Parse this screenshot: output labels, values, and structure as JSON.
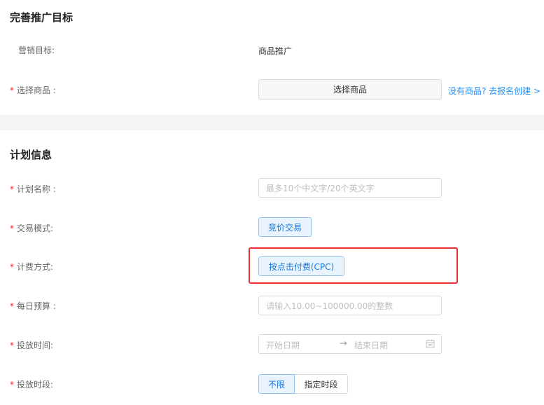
{
  "section1": {
    "title": "完善推广目标",
    "goal_label": "营销目标:",
    "goal_value": "商品推广",
    "product_label": "选择商品 :",
    "product_button": "选择商品",
    "product_link": "没有商品? 去报名创建 >"
  },
  "section2": {
    "title": "计划信息",
    "name_label": "计划名称 :",
    "name_placeholder": "最多10个中文字/20个英文字",
    "mode_label": "交易模式:",
    "mode_value": "竞价交易",
    "billing_label": "计费方式:",
    "billing_value": "按点击付费(CPC)",
    "budget_label": "每日预算 :",
    "budget_placeholder": "请输入10.00~100000.00的整数",
    "time_label": "投放时间:",
    "time_start": "开始日期",
    "time_arrow": "→",
    "time_end": "结束日期",
    "period_label": "投放时段:",
    "period_options": [
      "不限",
      "指定时段"
    ]
  },
  "required_mark": "*",
  "colors": {
    "accent": "#1677d9",
    "required": "#f5222d",
    "highlight": "#e8312f"
  }
}
